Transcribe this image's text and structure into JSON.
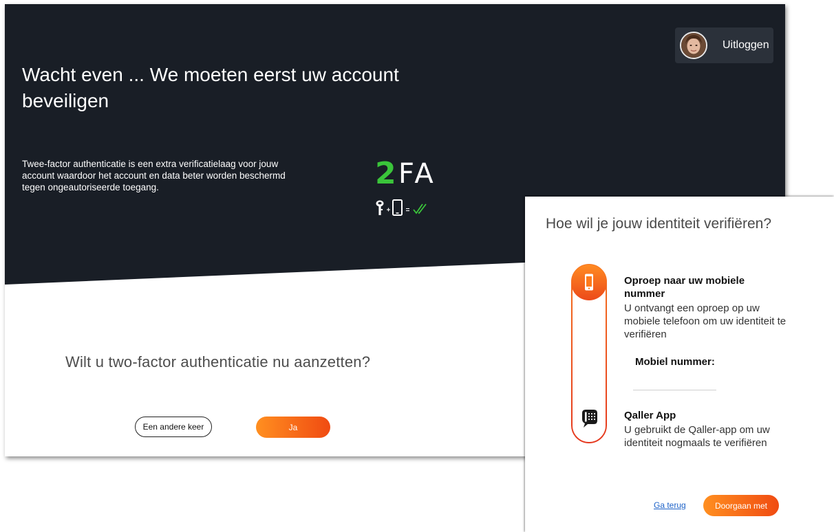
{
  "colors": {
    "dark_header": "#191e26",
    "accent_orange": "#ff7a1a",
    "accent_red": "#e8401c",
    "twofa_green": "#3ac43a",
    "link_blue": "#1d62c8"
  },
  "header": {
    "logout_label": "Uitloggen",
    "avatar_icon": "user-avatar"
  },
  "main": {
    "title": "Wacht even ... We moeten eerst uw account beveiligen",
    "intro": "Twee-factor authenticatie is een extra verificatielaag voor jouw account waardoor het account en data beter worden beschermd tegen ongeautoriseerde toegang.",
    "twofa_digit": "2",
    "twofa_letters": "FA",
    "twofa_icons": [
      "key-icon",
      "plus",
      "phone-icon",
      "equals",
      "double-check-icon"
    ],
    "question": "Wilt u two-factor authenticatie nu aanzetten?",
    "btn_later": "Een andere keer",
    "btn_yes": "Ja"
  },
  "verify": {
    "title": "Hoe wil je jouw identiteit verifiëren?",
    "option_call": {
      "icon": "mobile-phone-icon",
      "title": "Oproep naar uw mobiele nummer",
      "description": "U ontvangt een oproep op uw mobiele telefoon om uw identiteit te verifiëren"
    },
    "phone_label": "Mobiel nummer:",
    "phone_value": "",
    "option_app": {
      "icon": "qaller-app-icon",
      "title": "Qaller App",
      "description": "U gebruikt de Qaller-app om uw identiteit nogmaals te verifiëren"
    },
    "back_label": "Ga terug",
    "continue_label": "Doorgaan met"
  }
}
